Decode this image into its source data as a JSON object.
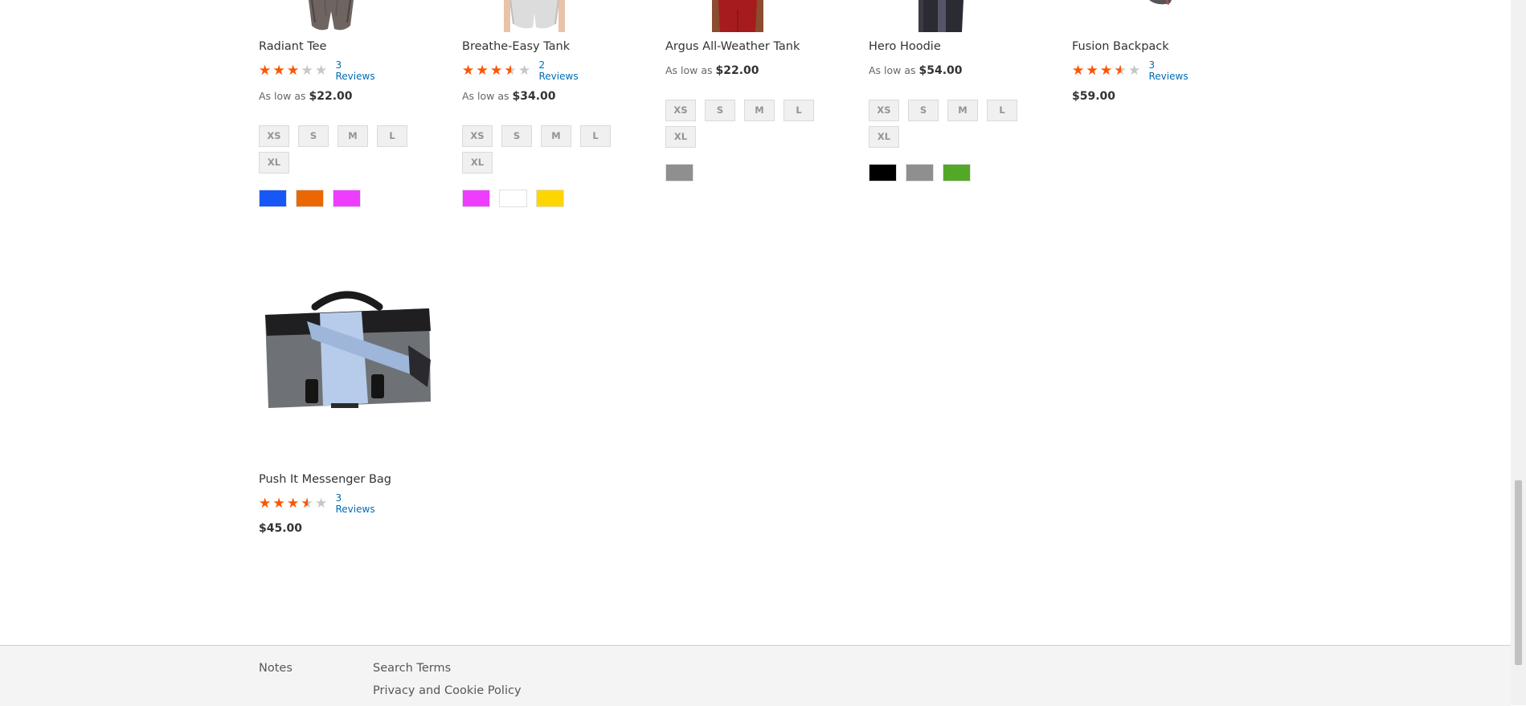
{
  "products": [
    {
      "name": "Radiant Tee",
      "rating": 3,
      "reviews": "3 Reviews",
      "price_prefix": "As low as",
      "price": "$22.00",
      "sizes": [
        "XS",
        "S",
        "M",
        "L",
        "XL"
      ],
      "colors": [
        "#1857f7",
        "#eb6703",
        "#ef3dff"
      ],
      "image": "tee-model-shorts"
    },
    {
      "name": "Breathe-Easy Tank",
      "rating": 3.5,
      "reviews": "2 Reviews",
      "price_prefix": "As low as",
      "price": "$34.00",
      "sizes": [
        "XS",
        "S",
        "M",
        "L",
        "XL"
      ],
      "colors": [
        "#ef3dff",
        "#ffffff",
        "#ffd500"
      ],
      "image": "tank-model-shorts"
    },
    {
      "name": "Argus All-Weather Tank",
      "price_prefix": "As low as",
      "price": "$22.00",
      "sizes": [
        "XS",
        "S",
        "M",
        "L",
        "XL"
      ],
      "colors": [
        "#8f8f8f"
      ],
      "image": "red-tank-model"
    },
    {
      "name": "Hero Hoodie",
      "price_prefix": "As low as",
      "price": "$54.00",
      "sizes": [
        "XS",
        "S",
        "M",
        "L",
        "XL"
      ],
      "colors": [
        "#000000",
        "#8f8f8f",
        "#53a828"
      ],
      "image": "hoodie-model"
    },
    {
      "name": "Fusion Backpack",
      "rating": 3.5,
      "reviews": "3 Reviews",
      "price": "$59.00",
      "image": "backpack"
    },
    {
      "name": "Push It Messenger Bag",
      "rating": 3.5,
      "reviews": "3 Reviews",
      "price": "$45.00",
      "image": "messenger-bag"
    }
  ],
  "footer": {
    "links": [
      "Notes",
      "Search Terms",
      "Privacy and Cookie Policy"
    ]
  },
  "colors": {
    "star_filled": "#ff5501",
    "star_empty": "#c7c7c7",
    "link": "#006bb4",
    "footer_bg": "#f4f4f4"
  }
}
